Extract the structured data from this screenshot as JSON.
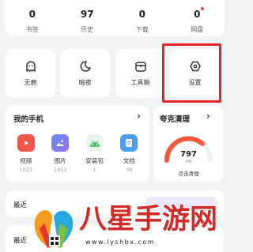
{
  "stats": [
    {
      "num": "0",
      "label": "书签"
    },
    {
      "num": "97",
      "label": "历史"
    },
    {
      "num": "0",
      "label": "下载"
    },
    {
      "num": "0",
      "label": "网盘"
    }
  ],
  "tools": [
    {
      "label": "无痕",
      "icon": "incognito-icon"
    },
    {
      "label": "暗夜",
      "icon": "moon-icon"
    },
    {
      "label": "工具箱",
      "icon": "toolbox-icon"
    },
    {
      "label": "设置",
      "icon": "gear-icon"
    }
  ],
  "my_phone": {
    "title": "我的手机",
    "arrow": "›",
    "apps": [
      {
        "label": "视频",
        "count": "1023",
        "icon": "video-icon",
        "color": "#f0564a"
      },
      {
        "label": "图片",
        "count": "1452",
        "icon": "image-icon",
        "color": "#6b7df2"
      },
      {
        "label": "安装包",
        "count": "1",
        "icon": "android-icon",
        "color": "#6fce7c"
      },
      {
        "label": "文档",
        "count": "30",
        "icon": "document-icon",
        "color": "#4b9ff0"
      }
    ]
  },
  "cleaner": {
    "title": "夸克清理",
    "arrow": "›",
    "value": "797",
    "unit": "MB",
    "action": "点击清理",
    "gauge_fraction": 0.72,
    "color": "#ef5a3c"
  },
  "recent": [
    {
      "label": "最近"
    },
    {
      "label": "最近"
    }
  ],
  "watermark": {
    "brand": "八星手游网",
    "url": "www.lyshbx.com"
  },
  "colors": {
    "highlight": "#e3252d",
    "brand": "#d22a26"
  }
}
